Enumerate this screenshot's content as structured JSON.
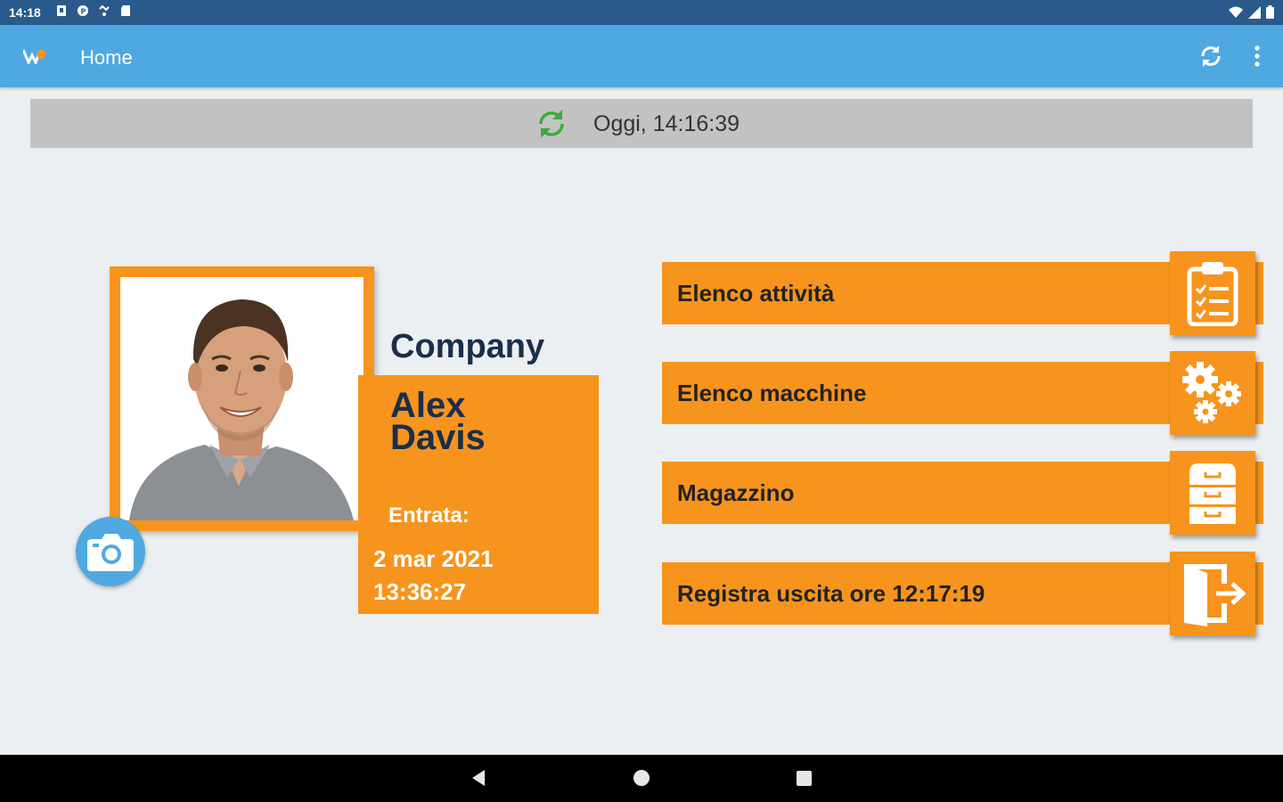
{
  "status_bar": {
    "time": "14:18",
    "icons": [
      "sim-icon",
      "vpn-icon",
      "wifi-calling-icon",
      "sd-card-icon"
    ],
    "right_icons": [
      "wifi-icon",
      "signal-icon",
      "battery-icon"
    ]
  },
  "app_bar": {
    "title": "Home",
    "accent": "#4fa9e0"
  },
  "sync_bar": {
    "text": "Oggi, 14:16:39"
  },
  "profile": {
    "company": "Company",
    "first_name": "Alex",
    "last_name": "Davis",
    "entrata_label": "Entrata:",
    "entrata_date": "2 mar 2021",
    "entrata_time": "13:36:27"
  },
  "menu": [
    {
      "label": "Elenco attività",
      "icon": "clipboard-checklist-icon"
    },
    {
      "label": "Elenco macchine",
      "icon": "gears-icon"
    },
    {
      "label": "Magazzino",
      "icon": "filing-cabinet-icon"
    },
    {
      "label": "Registra uscita ore 12:17:19",
      "icon": "exit-door-icon"
    }
  ],
  "colors": {
    "orange": "#f7941d",
    "navy_text": "#1b2e4a",
    "sync_green": "#3cab3c"
  }
}
